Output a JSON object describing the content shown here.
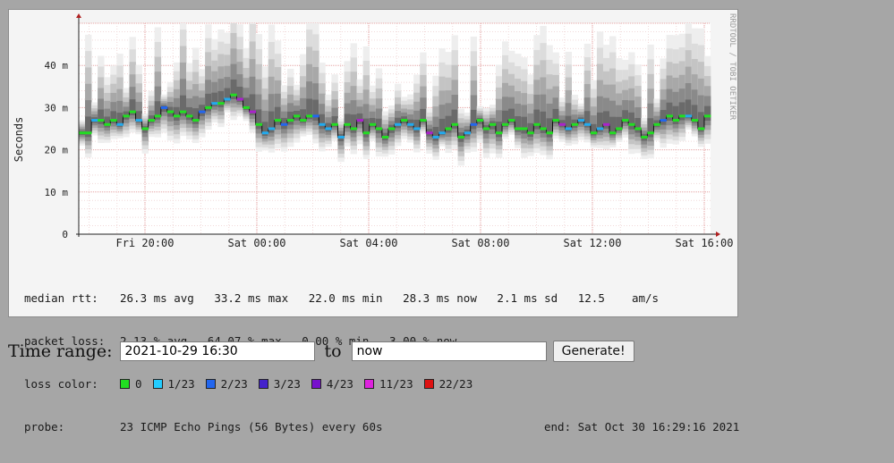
{
  "graph": {
    "watermark": "RRDTOOL / TOBI OETIKER",
    "ylabel": "Seconds",
    "y_ticks": [
      "0",
      "10 m",
      "20 m",
      "30 m",
      "40 m"
    ],
    "x_ticks": [
      "Fri 20:00",
      "Sat 00:00",
      "Sat 04:00",
      "Sat 08:00",
      "Sat 12:00",
      "Sat 16:00"
    ]
  },
  "chart_data": {
    "type": "line",
    "title": "",
    "ylabel": "Seconds",
    "ylim": [
      0,
      0.05
    ],
    "grid": true,
    "x_ticks": [
      "Fri 20:00",
      "Sat 00:00",
      "Sat 04:00",
      "Sat 08:00",
      "Sat 12:00",
      "Sat 16:00"
    ],
    "y_ticks_s": [
      0,
      0.01,
      0.02,
      0.03,
      0.04
    ],
    "series": [
      {
        "name": "median rtt",
        "values": [
          0.024,
          0.024,
          0.027,
          0.027,
          0.026,
          0.027,
          0.026,
          0.028,
          0.029,
          0.027,
          0.025,
          0.027,
          0.028,
          0.03,
          0.029,
          0.028,
          0.029,
          0.028,
          0.027,
          0.029,
          0.03,
          0.031,
          0.031,
          0.032,
          0.033,
          0.032,
          0.03,
          0.029,
          0.026,
          0.024,
          0.025,
          0.027,
          0.026,
          0.027,
          0.028,
          0.027,
          0.028,
          0.028,
          0.026,
          0.025,
          0.026,
          0.023,
          0.026,
          0.025,
          0.027,
          0.024,
          0.026,
          0.025,
          0.023,
          0.025,
          0.026,
          0.027,
          0.026,
          0.025,
          0.027,
          0.024,
          0.023,
          0.024,
          0.025,
          0.026,
          0.023,
          0.024,
          0.026,
          0.027,
          0.025,
          0.026,
          0.024,
          0.026,
          0.027,
          0.025,
          0.025,
          0.024,
          0.026,
          0.025,
          0.024,
          0.027,
          0.026,
          0.025,
          0.026,
          0.027,
          0.026,
          0.024,
          0.025,
          0.026,
          0.024,
          0.025,
          0.027,
          0.026,
          0.025,
          0.023,
          0.024,
          0.026,
          0.027,
          0.028,
          0.027,
          0.028,
          0.028,
          0.027,
          0.025,
          0.028
        ]
      }
    ],
    "stats": {
      "median_rtt": {
        "avg": "26.3 ms",
        "max": "33.2 ms",
        "min": "22.0 ms",
        "now": "28.3 ms",
        "sd": "2.1 ms",
        "am_s": "12.5"
      },
      "packet_loss": {
        "avg": "2.13 %",
        "max": "64.07 %",
        "min": "0.00 %",
        "now": "3.00 %"
      }
    }
  },
  "stats_lines": {
    "median_label": "median rtt:",
    "median_values": "26.3 ms avg   33.2 ms max   22.0 ms min   28.3 ms now   2.1 ms sd   12.5    am/s",
    "loss_label": "packet loss:",
    "loss_values": "2.13 % avg   64.07 % max   0.00 % min   3.00 % now",
    "loss_color_label": "loss color:",
    "loss_colors": [
      {
        "label": "0",
        "color": "#22dd22"
      },
      {
        "label": "1/23",
        "color": "#22ccff"
      },
      {
        "label": "2/23",
        "color": "#2266ee"
      },
      {
        "label": "3/23",
        "color": "#4422cc"
      },
      {
        "label": "4/23",
        "color": "#7711cc"
      },
      {
        "label": "11/23",
        "color": "#dd22dd"
      },
      {
        "label": "22/23",
        "color": "#dd1111"
      }
    ],
    "probe_label": "probe:",
    "probe_value": "23 ICMP Echo Pings (56 Bytes) every 60s",
    "probe_end": "end: Sat Oct 30 16:29:16 2021"
  },
  "time_range": {
    "label": "Time range:",
    "from_value": "2021-10-29 16:30",
    "to_label": "to",
    "to_value": "now",
    "button": "Generate!"
  }
}
